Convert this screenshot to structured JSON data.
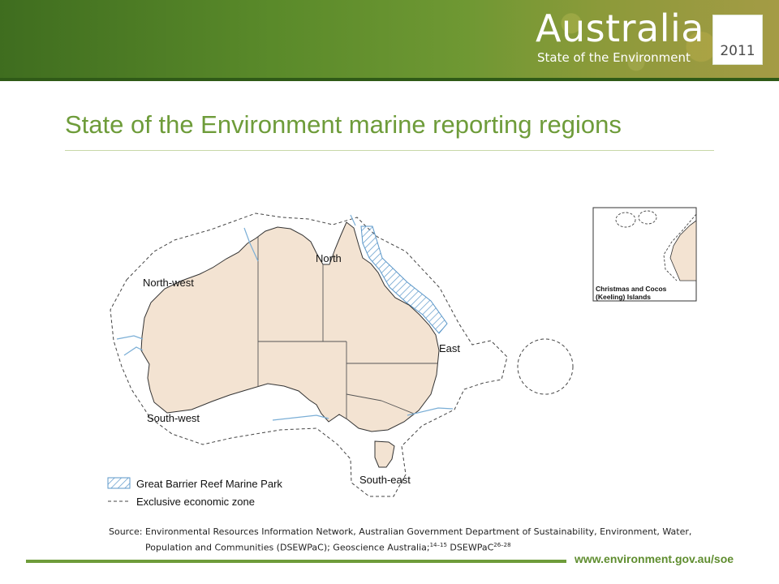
{
  "header": {
    "brand_title": "Australia",
    "brand_subtitle": "State of the Environment",
    "year": "2011"
  },
  "page": {
    "title": "State of the Environment marine reporting regions"
  },
  "map": {
    "regions": {
      "north": "North",
      "north_west": "North-west",
      "east": "East",
      "south_west": "South-west",
      "south_east": "South-east"
    },
    "inset_label_line1": "Christmas and Cocos",
    "inset_label_line2": "(Keeling) Islands",
    "legend": {
      "reef": "Great Barrier Reef Marine Park",
      "eez": "Exclusive economic zone"
    },
    "colors": {
      "land": "#f3e3d2",
      "border": "#555555",
      "boundary_line": "#7aaed6",
      "reef_hatch": "#5b97c9",
      "eez_dash": "#444444"
    }
  },
  "source": {
    "line1_prefix": "Source:",
    "line1": "Environmental Resources Information Network, Australian Government Department of Sustainability, Environment, Water,",
    "line2": "Population and Communities (DSEWPaC); Geoscience Australia;",
    "ref1": "14–15",
    "line2_mid": " DSEWPaC",
    "ref2": "26–28"
  },
  "footer": {
    "url": "www.environment.gov.au/soe",
    "accent_color": "#6e9c3a"
  }
}
